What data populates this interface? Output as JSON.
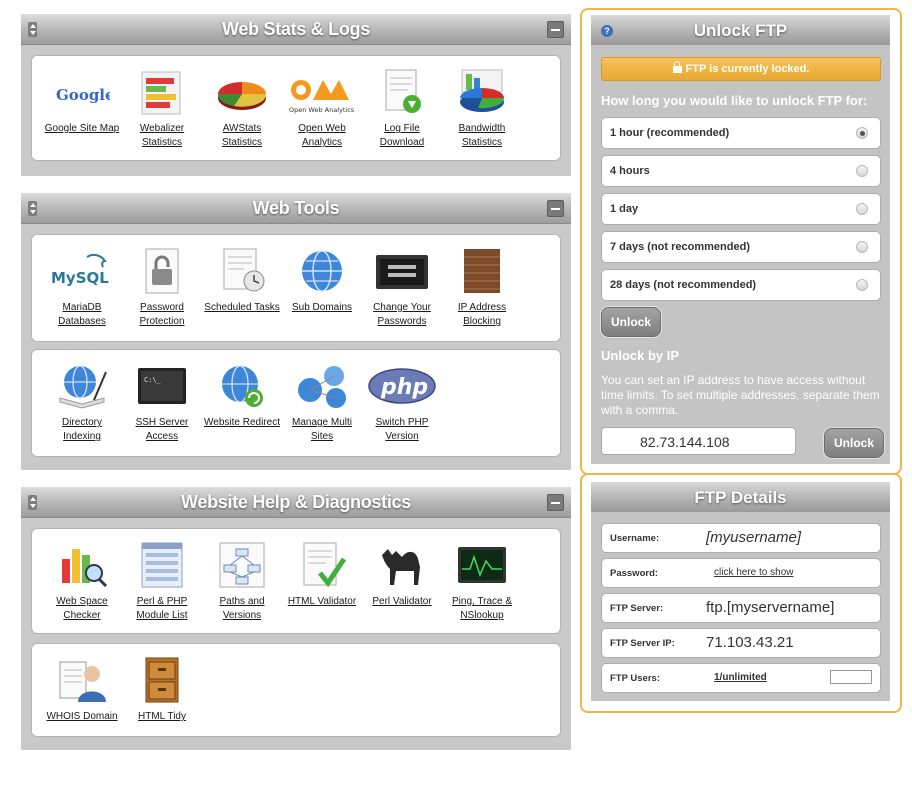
{
  "stats": {
    "title": "Web Stats & Logs",
    "tools": [
      {
        "l1": "Google Site Map",
        "l2": ""
      },
      {
        "l1": "Webalizer",
        "l2": "Statistics"
      },
      {
        "l1": "AWStats",
        "l2": "Statistics"
      },
      {
        "l1": "Open Web",
        "l2": "Analytics"
      },
      {
        "l1": "Log File",
        "l2": "Download"
      },
      {
        "l1": "Bandwidth",
        "l2": "Statistics"
      }
    ],
    "google_logo": "Google",
    "owa_logo": "Open Web Analytics"
  },
  "webtools": {
    "title": "Web Tools",
    "row1": [
      {
        "l1": "MariaDB",
        "l2": "Databases"
      },
      {
        "l1": "Password",
        "l2": "Protection"
      },
      {
        "l1": "Scheduled Tasks",
        "l2": ""
      },
      {
        "l1": "Sub Domains",
        "l2": ""
      },
      {
        "l1": "Change Your",
        "l2": "Passwords"
      },
      {
        "l1": "IP Address",
        "l2": "Blocking"
      }
    ],
    "row2": [
      {
        "l1": "Directory",
        "l2": "Indexing"
      },
      {
        "l1": "SSH Server",
        "l2": "Access"
      },
      {
        "l1": "Website Redirect",
        "l2": ""
      },
      {
        "l1": "Manage Multi",
        "l2": "Sites"
      },
      {
        "l1": "Switch PHP",
        "l2": "Version"
      }
    ],
    "mysql_logo": "MySQL",
    "php_logo": "php"
  },
  "help": {
    "title": "Website Help & Diagnostics",
    "row1": [
      {
        "l1": "Web Space",
        "l2": "Checker"
      },
      {
        "l1": "Perl & PHP",
        "l2": "Module List"
      },
      {
        "l1": "Paths and",
        "l2": "Versions"
      },
      {
        "l1": "HTML Validator",
        "l2": ""
      },
      {
        "l1": "Perl Validator",
        "l2": ""
      },
      {
        "l1": "Ping, Trace &",
        "l2": "NSlookup"
      }
    ],
    "row2": [
      {
        "l1": "WHOIS Domain",
        "l2": ""
      },
      {
        "l1": "HTML Tidy",
        "l2": ""
      }
    ]
  },
  "unlock": {
    "title": "Unlock FTP",
    "help": "?",
    "locked_text": "FTP is currently locked.",
    "question": "How long you would like to unlock FTP for:",
    "options": [
      "1 hour (recommended)",
      "4 hours",
      "1 day",
      "7 days (not recommended)",
      "28 days (not recommended)"
    ],
    "selected_index": 0,
    "unlock_button": "Unlock",
    "ip_heading": "Unlock by IP",
    "ip_desc": "You can set an IP address to have access without time limits. To set multiple addresses, separate them with a comma.",
    "ip_value": "82.73.144.108",
    "ip_button": "Unlock"
  },
  "details": {
    "title": "FTP Details",
    "username_label": "Username:",
    "username_value": "[myusername]",
    "password_label": "Password:",
    "password_value": "click here to show",
    "server_label": "FTP Server:",
    "server_value": "ftp.[myservername]",
    "ip_label": "FTP Server IP:",
    "ip_value": "71.103.43.21",
    "users_label": "FTP Users:",
    "users_value": "1/unlimited"
  }
}
